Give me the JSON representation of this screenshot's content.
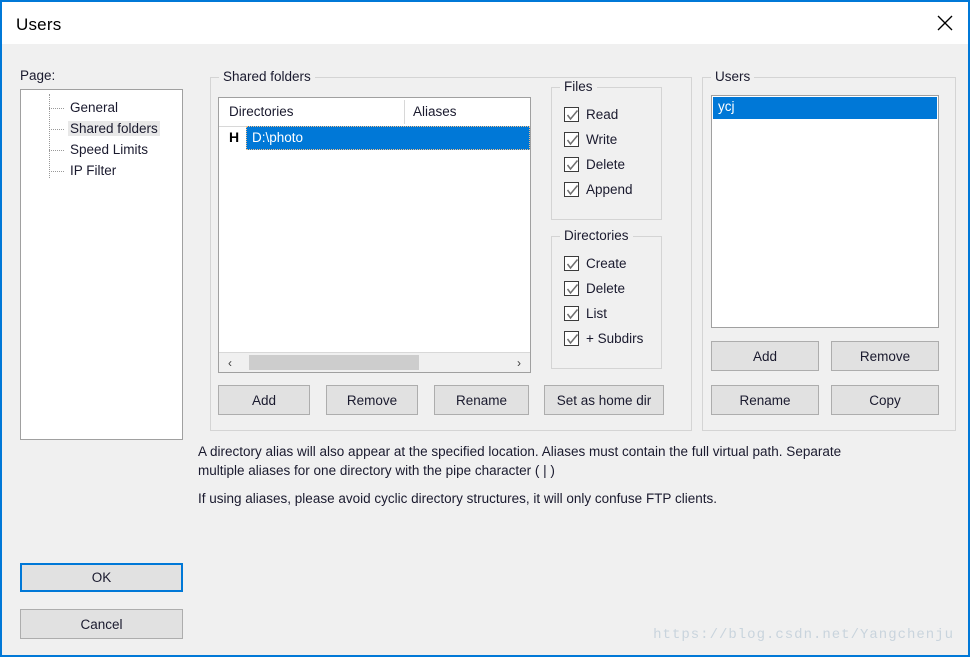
{
  "window": {
    "title": "Users",
    "close_icon": "close-icon"
  },
  "sidebar": {
    "label": "Page:",
    "items": [
      {
        "label": "General",
        "selected": false
      },
      {
        "label": "Shared folders",
        "selected": true
      },
      {
        "label": "Speed Limits",
        "selected": false
      },
      {
        "label": "IP Filter",
        "selected": false
      }
    ]
  },
  "shared_folders": {
    "group_title": "Shared folders",
    "columns": [
      "Directories",
      "Aliases"
    ],
    "rows": [
      {
        "home_marker": "H",
        "directory": "D:\\photo",
        "alias": "",
        "selected": true
      }
    ],
    "scrollbar": {
      "left_arrow": "‹",
      "right_arrow": "›"
    },
    "buttons": [
      {
        "label": "Add"
      },
      {
        "label": "Remove"
      },
      {
        "label": "Rename"
      },
      {
        "label": "Set as home dir"
      }
    ]
  },
  "files_group": {
    "title": "Files",
    "items": [
      {
        "label": "Read",
        "checked": true
      },
      {
        "label": "Write",
        "checked": true
      },
      {
        "label": "Delete",
        "checked": true
      },
      {
        "label": "Append",
        "checked": true
      }
    ]
  },
  "directories_group": {
    "title": "Directories",
    "items": [
      {
        "label": "Create",
        "checked": true
      },
      {
        "label": "Delete",
        "checked": true
      },
      {
        "label": "List",
        "checked": true
      },
      {
        "label": "+ Subdirs",
        "checked": true
      }
    ]
  },
  "users_group": {
    "title": "Users",
    "list": [
      {
        "name": "ycj",
        "selected": true
      }
    ],
    "buttons": [
      {
        "label": "Add"
      },
      {
        "label": "Remove"
      },
      {
        "label": "Rename"
      },
      {
        "label": "Copy"
      }
    ]
  },
  "description": {
    "paragraph1": "A directory alias will also appear at the specified location. Aliases must contain the full virtual path. Separate multiple aliases for one directory with the pipe character ( | )",
    "paragraph2": "If using aliases, please avoid cyclic directory structures, it will only confuse FTP clients."
  },
  "footer": {
    "ok_label": "OK",
    "cancel_label": "Cancel"
  },
  "watermark": "https://blog.csdn.net/Yangchenju",
  "colors": {
    "accent": "#0078d7",
    "dialog_bg": "#f0f0f0",
    "button_bg": "#e1e1e1",
    "selection_blue": "#0078d7",
    "tree_selection": "#e8e8e8",
    "watermark": "#c9d4dd"
  }
}
